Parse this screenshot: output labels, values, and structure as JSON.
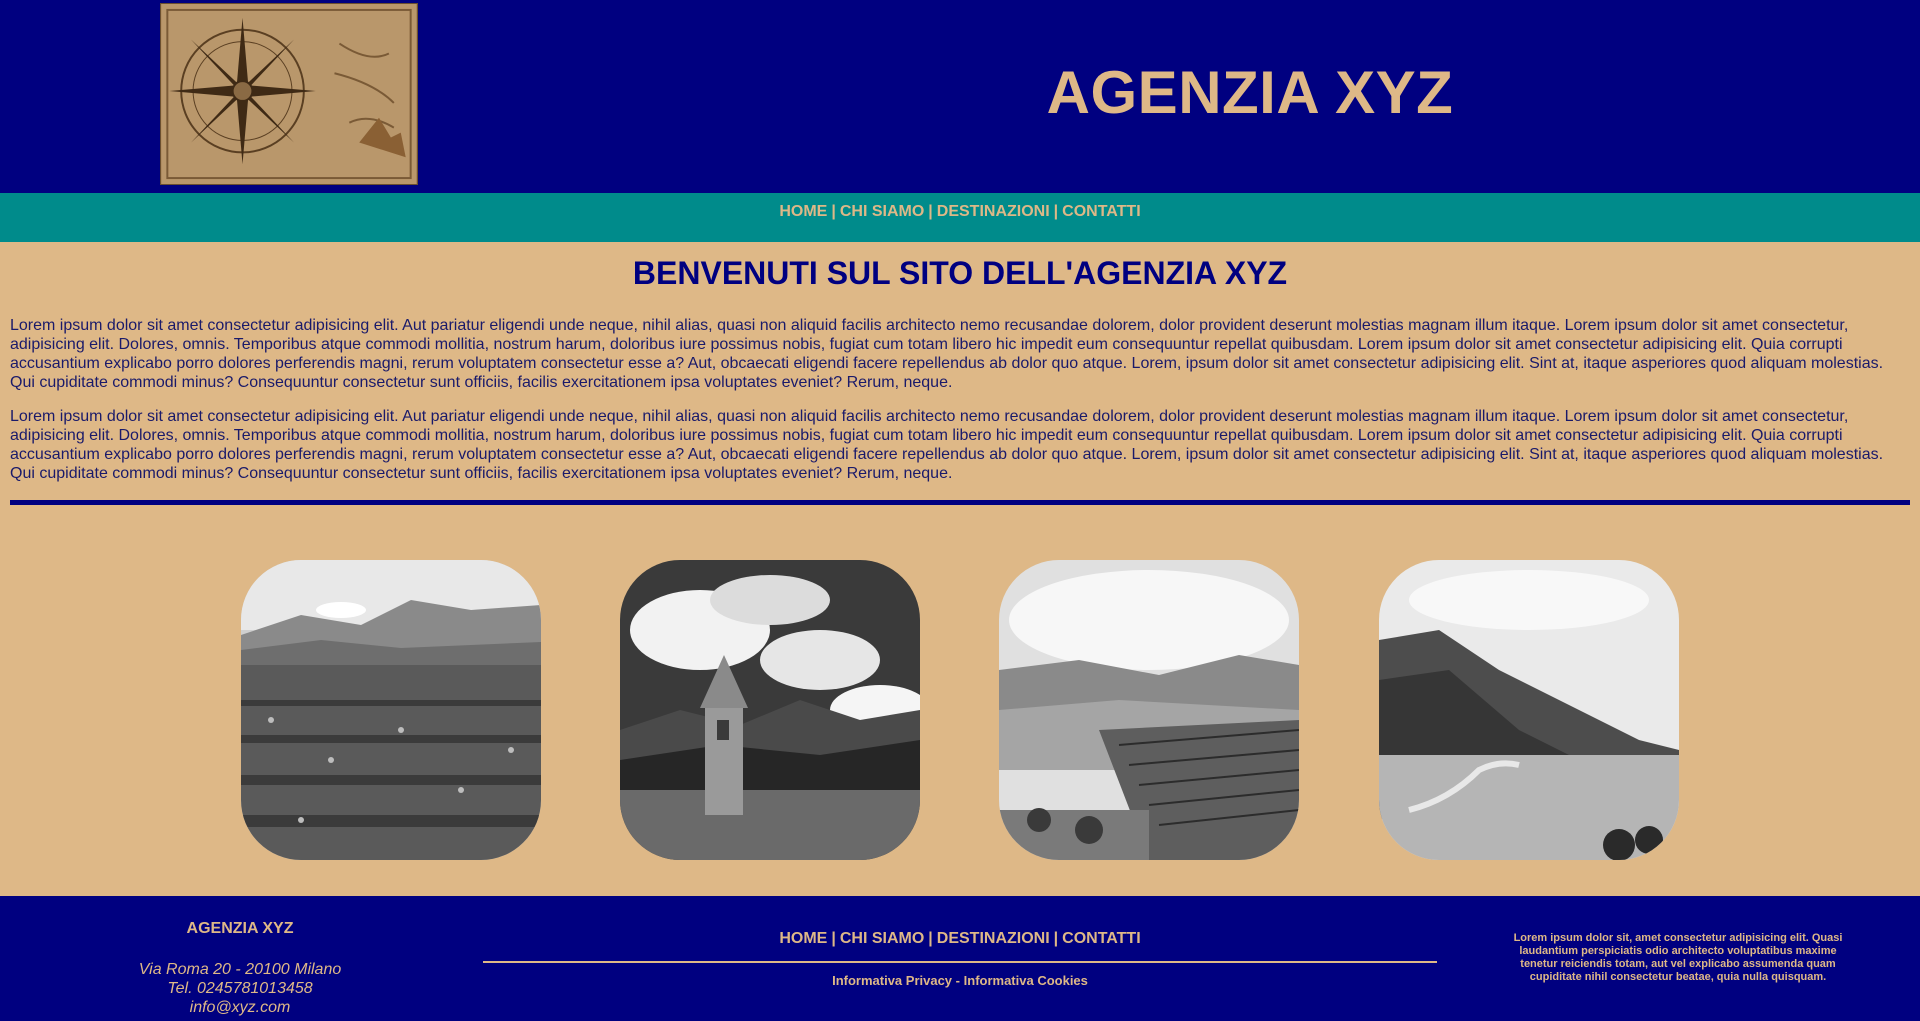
{
  "header": {
    "logo_icon": "compass-rose-map-icon",
    "title": "AGENZIA XYZ"
  },
  "nav": {
    "items": [
      {
        "label": "HOME"
      },
      {
        "label": "CHI SIAMO"
      },
      {
        "label": "DESTINAZIONI"
      },
      {
        "label": "CONTATTI"
      }
    ],
    "separator": "|"
  },
  "main": {
    "title": "BENVENUTI SUL SITO DELL'AGENZIA XYZ",
    "paragraphs": [
      "Lorem ipsum dolor sit amet consectetur adipisicing elit. Aut pariatur eligendi unde neque, nihil alias, quasi non aliquid facilis architecto nemo recusandae dolorem, dolor provident deserunt molestias magnam illum itaque. Lorem ipsum dolor sit amet consectetur, adipisicing elit. Dolores, omnis. Temporibus atque commodi mollitia, nostrum harum, doloribus iure possimus nobis, fugiat cum totam libero hic impedit eum consequuntur repellat quibusdam. Lorem ipsum dolor sit amet consectetur adipisicing elit. Quia corrupti accusantium explicabo porro dolores perferendis magni, rerum voluptatem consectetur esse a? Aut, obcaecati eligendi facere repellendus ab dolor quo atque. Lorem, ipsum dolor sit amet consectetur adipisicing elit. Sint at, itaque asperiores quod aliquam molestias. Qui cupiditate commodi minus? Consequuntur consectetur sunt officiis, facilis exercitationem ipsa voluptates eveniet? Rerum, neque.",
      "Lorem ipsum dolor sit amet consectetur adipisicing elit. Aut pariatur eligendi unde neque, nihil alias, quasi non aliquid facilis architecto nemo recusandae dolorem, dolor provident deserunt molestias magnam illum itaque. Lorem ipsum dolor sit amet consectetur, adipisicing elit. Dolores, omnis. Temporibus atque commodi mollitia, nostrum harum, doloribus iure possimus nobis, fugiat cum totam libero hic impedit eum consequuntur repellat quibusdam. Lorem ipsum dolor sit amet consectetur adipisicing elit. Quia corrupti accusantium explicabo porro dolores perferendis magni, rerum voluptatem consectetur esse a? Aut, obcaecati eligendi facere repellendus ab dolor quo atque. Lorem, ipsum dolor sit amet consectetur adipisicing elit. Sint at, itaque asperiores quod aliquam molestias. Qui cupiditate commodi minus? Consequuntur consectetur sunt officiis, facilis exercitationem ipsa voluptates eveniet? Rerum, neque."
    ]
  },
  "gallery": {
    "photos": [
      {
        "icon": "flower-field-mountains-photo"
      },
      {
        "icon": "bell-tower-in-lake-photo"
      },
      {
        "icon": "vineyard-hills-photo"
      },
      {
        "icon": "coastal-cove-photo"
      }
    ]
  },
  "footer": {
    "brand": "AGENZIA XYZ",
    "address": "Via Roma 20 - 20100 Milano",
    "phone": "Tel. 0245781013458",
    "email": "info@xyz.com",
    "nav": [
      {
        "label": "HOME"
      },
      {
        "label": "CHI SIAMO"
      },
      {
        "label": "DESTINAZIONI"
      },
      {
        "label": "CONTATTI"
      }
    ],
    "privacy_label": "Informativa Privacy",
    "legal_separator": "-",
    "cookies_label": "Informativa Cookies",
    "blurb": "Lorem ipsum dolor sit, amet consectetur adipisicing elit. Quasi laudantium perspiciatis odio architecto voluptatibus maxime tenetur reiciendis totam, aut vel explicabo assumenda quam cupiditate nihil consectetur beatae, quia nulla quisquam."
  },
  "colors": {
    "navy": "#000080",
    "teal": "#008b8b",
    "tan": "#deb887"
  }
}
